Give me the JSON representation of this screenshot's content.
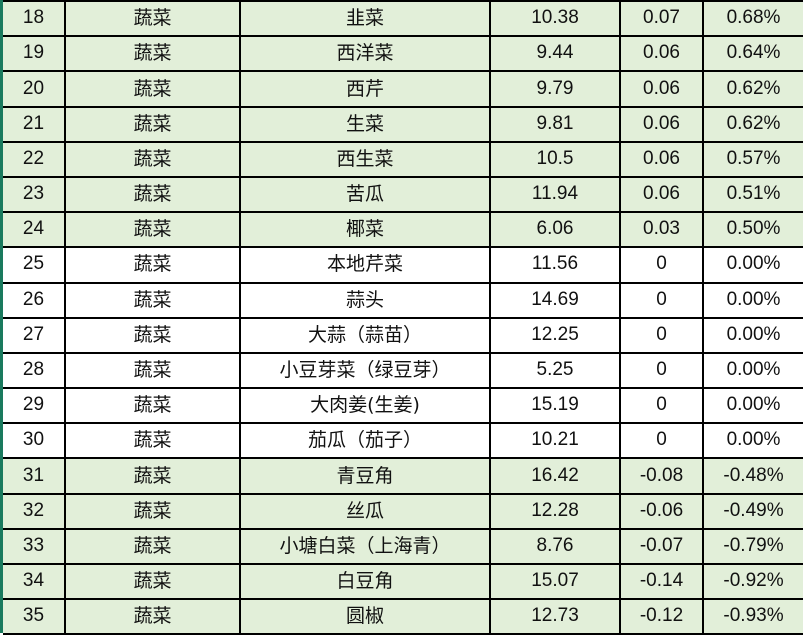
{
  "table": {
    "name": "vegetable-price-change-table",
    "columns": [
      {
        "key": "index",
        "name": "row-number"
      },
      {
        "key": "category",
        "name": "category"
      },
      {
        "key": "product",
        "name": "product-name"
      },
      {
        "key": "price",
        "name": "price"
      },
      {
        "key": "change",
        "name": "absolute-change"
      },
      {
        "key": "percent",
        "name": "percent-change"
      }
    ],
    "colors": {
      "row_highlight": "#e2efd9",
      "row_plain": "#ffffff",
      "grid_line": "#000000",
      "left_accent": "#1a7a5e",
      "text": "#111111"
    },
    "rows": [
      {
        "index": "18",
        "category": "蔬菜",
        "product": "韭菜",
        "price": "10.38",
        "change": "0.07",
        "percent": "0.68%",
        "shade": "green"
      },
      {
        "index": "19",
        "category": "蔬菜",
        "product": "西洋菜",
        "price": "9.44",
        "change": "0.06",
        "percent": "0.64%",
        "shade": "green"
      },
      {
        "index": "20",
        "category": "蔬菜",
        "product": "西芹",
        "price": "9.79",
        "change": "0.06",
        "percent": "0.62%",
        "shade": "green"
      },
      {
        "index": "21",
        "category": "蔬菜",
        "product": "生菜",
        "price": "9.81",
        "change": "0.06",
        "percent": "0.62%",
        "shade": "green"
      },
      {
        "index": "22",
        "category": "蔬菜",
        "product": "西生菜",
        "price": "10.5",
        "change": "0.06",
        "percent": "0.57%",
        "shade": "green"
      },
      {
        "index": "23",
        "category": "蔬菜",
        "product": "苦瓜",
        "price": "11.94",
        "change": "0.06",
        "percent": "0.51%",
        "shade": "green"
      },
      {
        "index": "24",
        "category": "蔬菜",
        "product": "椰菜",
        "price": "6.06",
        "change": "0.03",
        "percent": "0.50%",
        "shade": "green"
      },
      {
        "index": "25",
        "category": "蔬菜",
        "product": "本地芹菜",
        "price": "11.56",
        "change": "0",
        "percent": "0.00%",
        "shade": "white"
      },
      {
        "index": "26",
        "category": "蔬菜",
        "product": "蒜头",
        "price": "14.69",
        "change": "0",
        "percent": "0.00%",
        "shade": "white"
      },
      {
        "index": "27",
        "category": "蔬菜",
        "product": "大蒜（蒜苗）",
        "price": "12.25",
        "change": "0",
        "percent": "0.00%",
        "shade": "white"
      },
      {
        "index": "28",
        "category": "蔬菜",
        "product": "小豆芽菜（绿豆芽）",
        "price": "5.25",
        "change": "0",
        "percent": "0.00%",
        "shade": "white"
      },
      {
        "index": "29",
        "category": "蔬菜",
        "product": "大肉姜(生姜)",
        "price": "15.19",
        "change": "0",
        "percent": "0.00%",
        "shade": "white"
      },
      {
        "index": "30",
        "category": "蔬菜",
        "product": "茄瓜（茄子）",
        "price": "10.21",
        "change": "0",
        "percent": "0.00%",
        "shade": "white"
      },
      {
        "index": "31",
        "category": "蔬菜",
        "product": "青豆角",
        "price": "16.42",
        "change": "-0.08",
        "percent": "-0.48%",
        "shade": "green"
      },
      {
        "index": "32",
        "category": "蔬菜",
        "product": "丝瓜",
        "price": "12.28",
        "change": "-0.06",
        "percent": "-0.49%",
        "shade": "green"
      },
      {
        "index": "33",
        "category": "蔬菜",
        "product": "小塘白菜（上海青）",
        "price": "8.76",
        "change": "-0.07",
        "percent": "-0.79%",
        "shade": "green"
      },
      {
        "index": "34",
        "category": "蔬菜",
        "product": "白豆角",
        "price": "15.07",
        "change": "-0.14",
        "percent": "-0.92%",
        "shade": "green"
      },
      {
        "index": "35",
        "category": "蔬菜",
        "product": "圆椒",
        "price": "12.73",
        "change": "-0.12",
        "percent": "-0.93%",
        "shade": "green"
      }
    ]
  }
}
